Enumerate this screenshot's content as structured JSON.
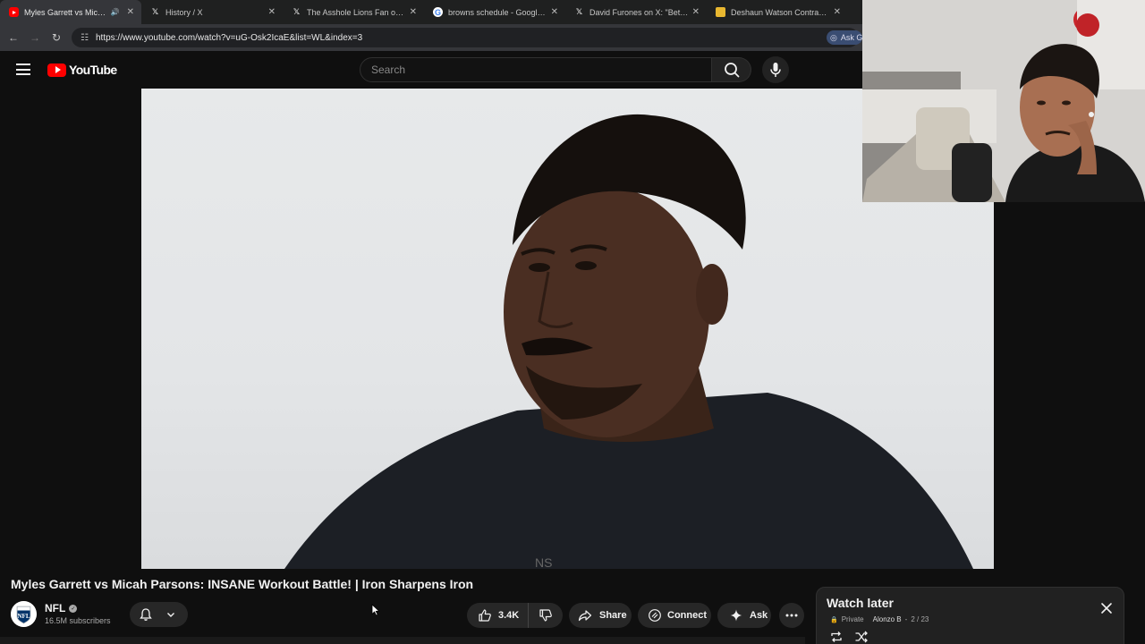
{
  "browser": {
    "tabs": [
      {
        "title": "Myles Garrett vs Micah Pars",
        "favicon": "youtube-favicon",
        "active": true,
        "audio": true
      },
      {
        "title": "History / X",
        "favicon": "x-favicon"
      },
      {
        "title": "The Asshole Lions Fan on X: \"h",
        "favicon": "x-favicon"
      },
      {
        "title": "browns schedule - Google Sear",
        "favicon": "google-favicon"
      },
      {
        "title": "David Furones on X: \"BetMGM",
        "favicon": "x-favicon"
      },
      {
        "title": "Deshaun Watson Contract, Sala",
        "favicon": "document-favicon"
      }
    ],
    "url": "https://www.youtube.com/watch?v=uG-Osk2IcaE&list=WL&index=3",
    "ask_chip": "Ask G"
  },
  "youtube": {
    "logo_text": "YouTube",
    "search_placeholder": "Search"
  },
  "video": {
    "title": "Myles Garrett vs Micah Parsons: INSANE Workout Battle! | Iron Sharpens Iron",
    "channel": {
      "name": "NFL",
      "subscribers": "16.5M subscribers",
      "avatar_text": "NFL"
    },
    "actions": {
      "likes": "3.4K",
      "share": "Share",
      "connect": "Connect",
      "ask": "Ask"
    },
    "shirt_text": "NS"
  },
  "playlist": {
    "title": "Watch later",
    "privacy": "Private",
    "owner": "Alonzo B",
    "position": "2 / 23"
  },
  "colors": {
    "brand_red": "#ff0000",
    "page_bg": "#0f0f0f",
    "pill_bg": "#272727"
  }
}
